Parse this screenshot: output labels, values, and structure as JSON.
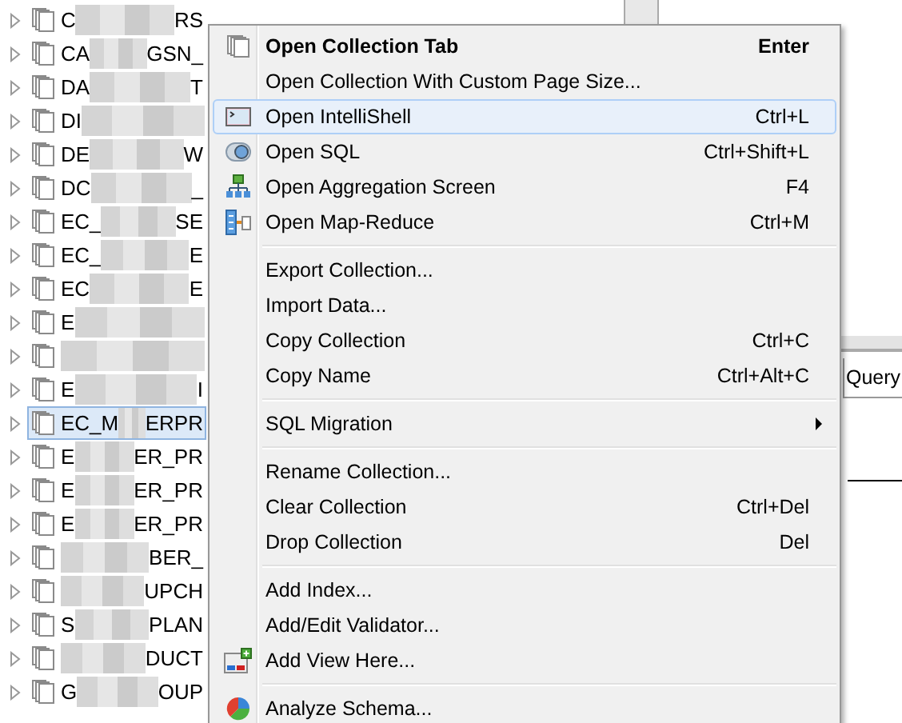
{
  "tree": {
    "items": [
      {
        "prefix": "C",
        "suffix": "RS",
        "selected": false
      },
      {
        "prefix": "CA",
        "suffix": "GSN_",
        "selected": false
      },
      {
        "prefix": "DA",
        "suffix": "T",
        "selected": false
      },
      {
        "prefix": "DI",
        "selected": false
      },
      {
        "prefix": "DE",
        "suffix": "W",
        "selected": false
      },
      {
        "prefix": "DC",
        "suffix": "_",
        "selected": false
      },
      {
        "prefix": "EC_",
        "suffix": "SE",
        "selected": false
      },
      {
        "prefix": "EC_",
        "suffix": "E",
        "selected": false
      },
      {
        "prefix": "EC",
        "suffix": "E",
        "selected": false
      },
      {
        "prefix": "E",
        "selected": false
      },
      {
        "selected": false
      },
      {
        "prefix": "E",
        "suffix": "I",
        "selected": false
      },
      {
        "prefix": "EC_M",
        "suffix": "ERPR",
        "selected": true
      },
      {
        "prefix": "E",
        "suffix": "ER_PR",
        "selected": false
      },
      {
        "prefix": "E",
        "suffix": "ER_PR",
        "selected": false
      },
      {
        "prefix": "E",
        "suffix": "ER_PR",
        "selected": false
      },
      {
        "suffix": "BER_",
        "selected": false
      },
      {
        "suffix": "UPCH",
        "selected": false
      },
      {
        "prefix": "S",
        "suffix": "PLAN",
        "selected": false
      },
      {
        "suffix": "DUCT",
        "selected": false
      },
      {
        "prefix": "G",
        "suffix": "OUP",
        "selected": false
      }
    ]
  },
  "background": {
    "tab_label": "Query"
  },
  "menu": {
    "items": [
      {
        "kind": "default",
        "label": "Open Collection Tab",
        "shortcut": "Enter",
        "selected": false
      },
      {
        "kind": "item",
        "label": "Open Collection With Custom Page Size...",
        "selected": false
      },
      {
        "kind": "item",
        "label": "Open IntelliShell",
        "shortcut": "Ctrl+L",
        "selected": true
      },
      {
        "kind": "item",
        "label": "Open SQL",
        "shortcut": "Ctrl+Shift+L",
        "selected": false
      },
      {
        "kind": "item",
        "label": "Open Aggregation Screen",
        "shortcut": "F4",
        "selected": false
      },
      {
        "kind": "item",
        "label": "Open Map-Reduce",
        "shortcut": "Ctrl+M",
        "selected": false
      },
      {
        "kind": "separator"
      },
      {
        "kind": "item",
        "label": "Export Collection...",
        "selected": false
      },
      {
        "kind": "item",
        "label": "Import Data...",
        "selected": false
      },
      {
        "kind": "item",
        "label": "Copy Collection",
        "shortcut": "Ctrl+C",
        "selected": false
      },
      {
        "kind": "item",
        "label": "Copy Name",
        "shortcut": "Ctrl+Alt+C",
        "selected": false
      },
      {
        "kind": "separator"
      },
      {
        "kind": "submenu",
        "label": "SQL Migration",
        "selected": false
      },
      {
        "kind": "separator"
      },
      {
        "kind": "item",
        "label": "Rename Collection...",
        "selected": false
      },
      {
        "kind": "item",
        "label": "Clear Collection",
        "shortcut": "Ctrl+Del",
        "selected": false
      },
      {
        "kind": "item",
        "label": "Drop Collection",
        "shortcut": "Del",
        "selected": false
      },
      {
        "kind": "separator"
      },
      {
        "kind": "item",
        "label": "Add Index...",
        "selected": false
      },
      {
        "kind": "item",
        "label": "Add/Edit Validator...",
        "selected": false
      },
      {
        "kind": "item",
        "label": "Add View Here...",
        "selected": false
      },
      {
        "kind": "separator"
      },
      {
        "kind": "item",
        "label": "Analyze Schema...",
        "selected": false
      }
    ]
  }
}
